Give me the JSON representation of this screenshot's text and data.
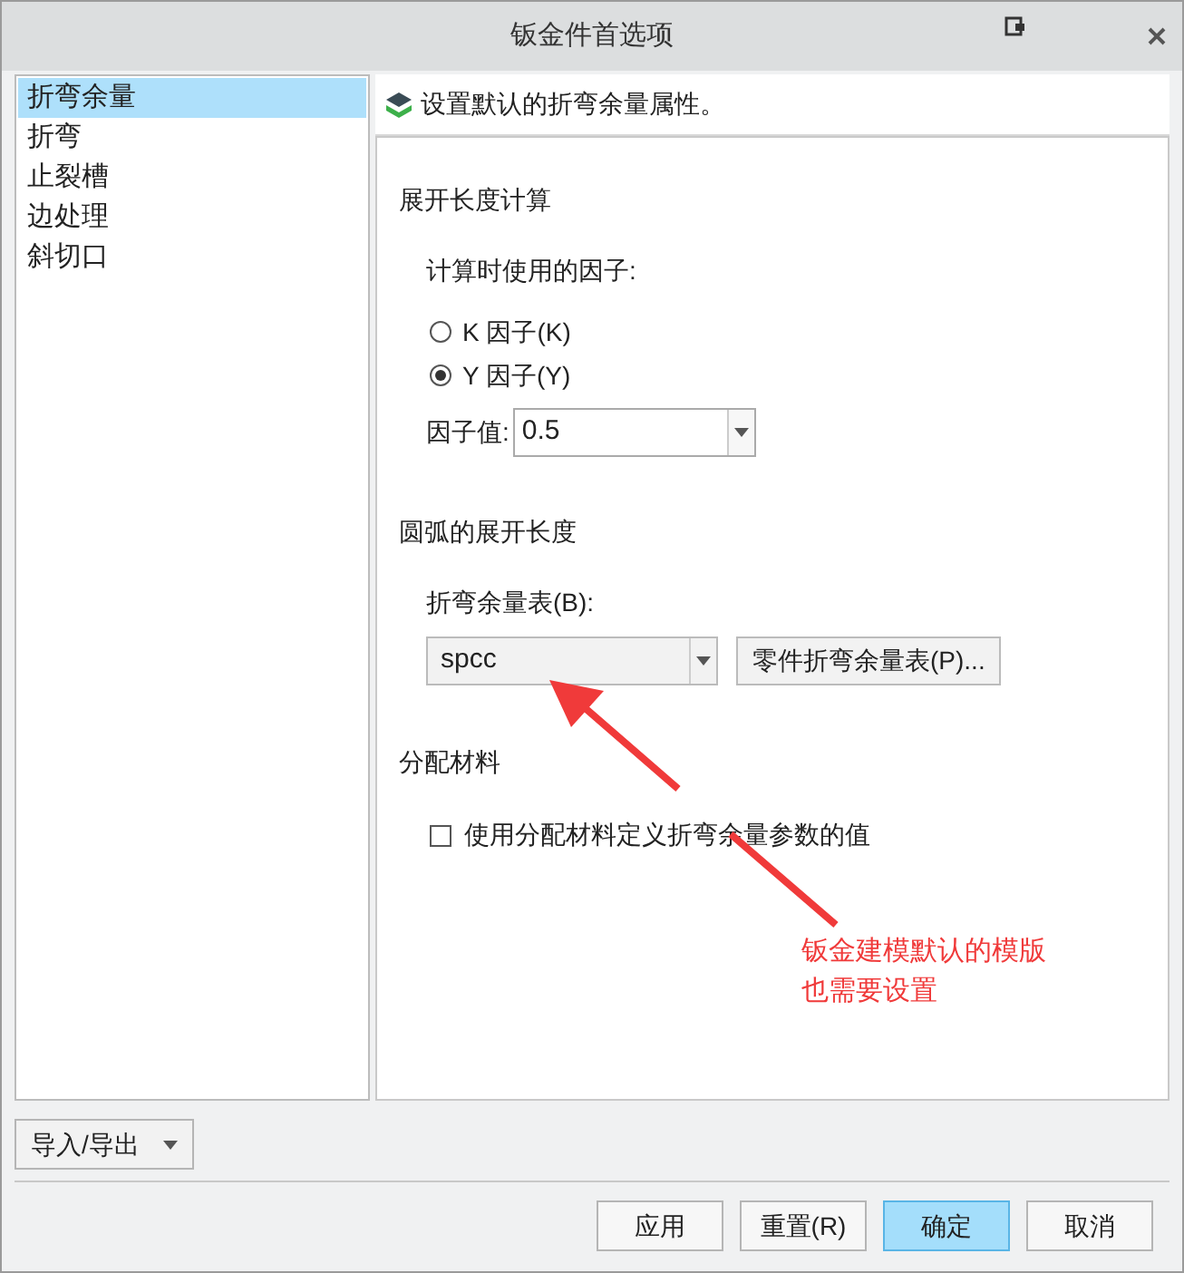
{
  "window": {
    "title": "钣金件首选项"
  },
  "sidebar": {
    "items": [
      {
        "label": "折弯余量",
        "selected": true
      },
      {
        "label": "折弯",
        "selected": false
      },
      {
        "label": "止裂槽",
        "selected": false
      },
      {
        "label": "边处理",
        "selected": false
      },
      {
        "label": "斜切口",
        "selected": false
      }
    ]
  },
  "panel": {
    "header": "设置默认的折弯余量属性。",
    "developed_length": {
      "title": "展开长度计算",
      "factor_label": "计算时使用的因子:",
      "factors": [
        {
          "label": "K 因子(K)",
          "selected": false
        },
        {
          "label": "Y 因子(Y)",
          "selected": true
        }
      ],
      "value_label": "因子值:",
      "value": "0.5"
    },
    "arc_length": {
      "title": "圆弧的展开长度",
      "table_label": "折弯余量表(B):",
      "table_value": "spcc",
      "part_table_button": "零件折弯余量表(P)..."
    },
    "material": {
      "title": "分配材料",
      "checkbox": {
        "label": "使用分配材料定义折弯余量参数的值",
        "checked": false
      }
    }
  },
  "annotation": {
    "lines": [
      "钣金建模默认的模版",
      "也需要设置"
    ]
  },
  "import_export": "导入/导出",
  "buttons": [
    {
      "label": "应用",
      "primary": false
    },
    {
      "label": "重置(R)",
      "primary": false
    },
    {
      "label": "确定",
      "primary": true
    },
    {
      "label": "取消",
      "primary": false
    }
  ]
}
